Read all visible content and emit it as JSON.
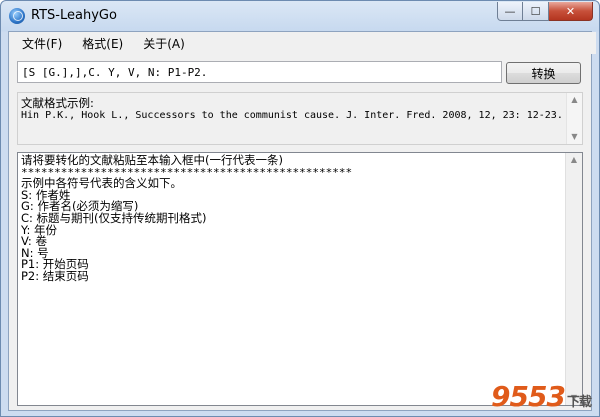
{
  "window": {
    "title": "RTS-LeahyGo",
    "buttons": {
      "minimize": "—",
      "maximize": "☐",
      "close": "✕"
    }
  },
  "menu": {
    "items": [
      {
        "label": "文件(F)"
      },
      {
        "label": "格式(E)"
      },
      {
        "label": "关于(A)"
      }
    ]
  },
  "format_input": {
    "value": "[S [G.],],C. Y, V, N: P1-P2."
  },
  "convert_button": {
    "label": "转换"
  },
  "example": {
    "label": "文献格式示例:",
    "text": "Hin P.K., Hook L., Successors to the communist cause. J. Inter. Fred. 2008, 12, 23: 12-23."
  },
  "main": {
    "lines": [
      "请将要转化的文献粘贴至本输入框中(一行代表一条)",
      "**************************************************",
      "示例中各符号代表的含义如下。",
      "S: 作者姓",
      "G: 作者名(必须为缩写)",
      "C: 标题与期刊(仅支持传统期刊格式)",
      "Y: 年份",
      "V: 卷",
      "N: 号",
      "P1: 开始页码",
      "P2: 结束页码"
    ]
  },
  "watermark": {
    "brand": "9553",
    "suffix": "下载"
  },
  "colors": {
    "accent": "#2b73c6",
    "close": "#c7503a"
  }
}
